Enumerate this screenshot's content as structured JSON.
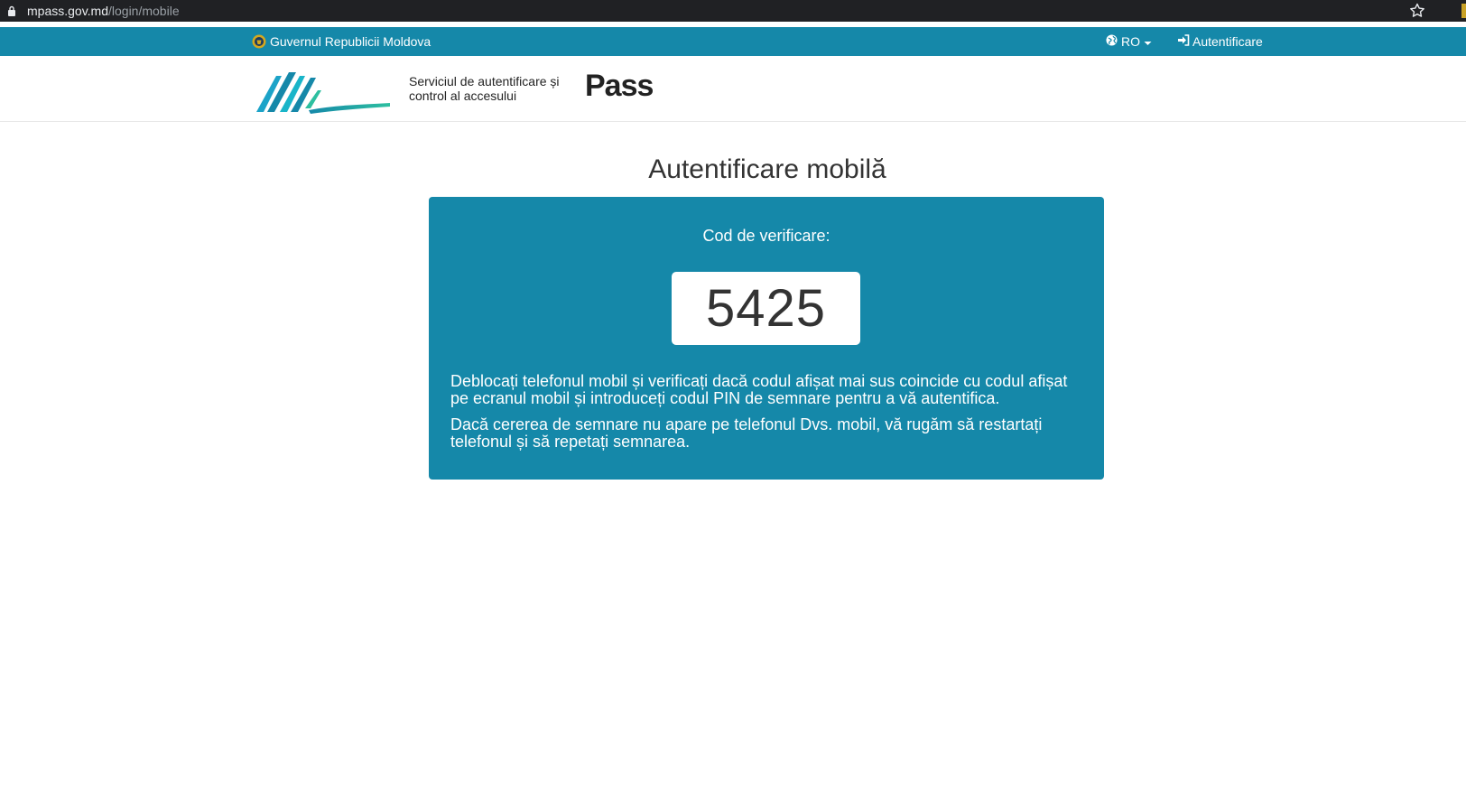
{
  "browser": {
    "url_host": "mpass.gov.md",
    "url_path": "/login/mobile"
  },
  "govbar": {
    "government": "Guvernul Republicii Moldova",
    "language": "RO",
    "login": "Autentificare"
  },
  "header": {
    "logo_text": "Pass",
    "tagline_line1": "Serviciul de autentificare și",
    "tagline_line2": "control al accesului"
  },
  "main": {
    "title": "Autentificare mobilă",
    "code_label": "Cod de verificare:",
    "code": "5425",
    "message1": "Deblocați telefonul mobil și verificați dacă codul afișat mai sus coincide cu codul afișat pe ecranul mobil și introduceți codul PIN de semnare pentru a vă autentifica.",
    "message2": "Dacă cererea de semnare nu apare pe telefonul Dvs. mobil, vă rugăm să restartați telefonul și să repetați semnarea."
  },
  "colors": {
    "brand_teal": "#1588a9",
    "browser_chrome": "#202124"
  }
}
